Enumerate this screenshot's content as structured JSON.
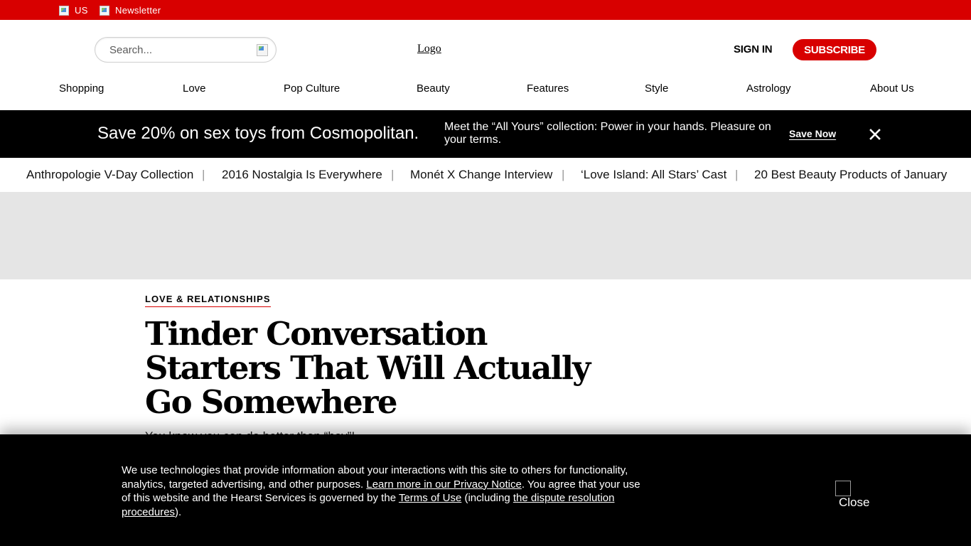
{
  "topbar": {
    "edition_label": "US",
    "newsletter_label": "Newsletter"
  },
  "header": {
    "search_placeholder": "Search...",
    "logo_alt": "Logo",
    "signin_label": "SIGN IN",
    "subscribe_label": "SUBSCRIBE"
  },
  "nav": {
    "items": [
      "Shopping",
      "Love",
      "Pop Culture",
      "Beauty",
      "Features",
      "Style",
      "Astrology",
      "About Us"
    ]
  },
  "promo": {
    "headline": "Save 20% on sex toys from Cosmopolitan.",
    "description": "Meet the “All Yours” collection: Power in your hands. Pleasure on your terms.",
    "cta_label": "Save Now"
  },
  "trending": {
    "items": [
      "Anthropologie V-Day Collection",
      "2016 Nostalgia Is Everywhere",
      "Monét X Change Interview",
      "‘Love Island: All Stars’ Cast",
      "20 Best Beauty Products of January"
    ],
    "separator": "|"
  },
  "article": {
    "section": "LOVE & RELATIONSHIPS",
    "title": "Tinder Conversation Starters That Will Actually Go Somewhere",
    "dek": "You know you can do better than “hey”!"
  },
  "cookie": {
    "text_part1": "We use technologies that provide information about your interactions with this site to others for functionality, analytics, targeted advertising, and other purposes.",
    "privacy_link": "Learn more in our Privacy Notice",
    "text_part2": ". You agree that your use of this website and the Hearst Services is governed by the",
    "terms_link": "Terms of Use",
    "text_part3": "(including",
    "dispute_link": "the dispute resolution procedures",
    "text_part4": ").",
    "close_label": "Close"
  },
  "colors": {
    "brand_red": "#d80000",
    "banner_black": "#000000",
    "ad_gray": "#e5e5e5"
  },
  "icons": {
    "edition": "broken-image-icon",
    "newsletter": "broken-image-icon",
    "search": "broken-image-icon",
    "promo_close": "close-icon",
    "cookie_close": "broken-image-icon"
  }
}
